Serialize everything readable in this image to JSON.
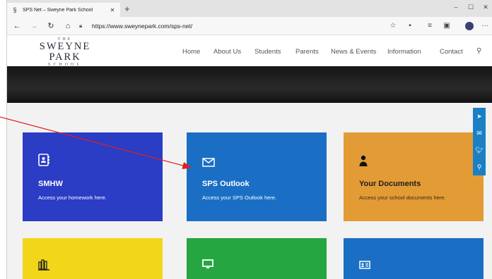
{
  "browser": {
    "tab_title": "SPS Net – Sweyne Park School",
    "tab_favicon": "sps-logo-icon",
    "new_tab": "+",
    "url": "https://www.sweyneparkcom/sps-net/",
    "url_display": "https://www.sweynepark.com/sps-net/",
    "minimize": "–",
    "maximize": "☐",
    "close": "✕",
    "back": "←",
    "forward": "→",
    "refresh": "↻",
    "home": "⌂",
    "more": "···"
  },
  "site": {
    "logo": {
      "the": "THE",
      "name": "SWEYNE PARK",
      "school": "SCHOOL"
    },
    "nav": [
      "Home",
      "About Us",
      "Students",
      "Parents",
      "News & Events",
      "Information",
      "Contact"
    ]
  },
  "cards": [
    {
      "title": "SMHW",
      "desc": "Access your homework here.",
      "icon": "contacts-book-icon",
      "color": "#2b3cc5"
    },
    {
      "title": "SPS Outlook",
      "desc": "Access your SPS Outlook here.",
      "icon": "envelope-icon",
      "color": "#1a6fc4"
    },
    {
      "title": "Your Documents",
      "desc": "Access your school documents here.",
      "icon": "user-icon",
      "color": "#e39b35"
    },
    {
      "title": "",
      "desc": "",
      "icon": "library-icon",
      "color": "#f2d61a"
    },
    {
      "title": "",
      "desc": "",
      "icon": "monitor-icon",
      "color": "#25a640"
    },
    {
      "title": "",
      "desc": "",
      "icon": "id-card-icon",
      "color": "#1a6fc4"
    }
  ],
  "social": [
    "paper-plane-icon",
    "mail-icon",
    "twitter-icon",
    "search-icon"
  ],
  "annotation": {
    "color": "#e02020"
  }
}
